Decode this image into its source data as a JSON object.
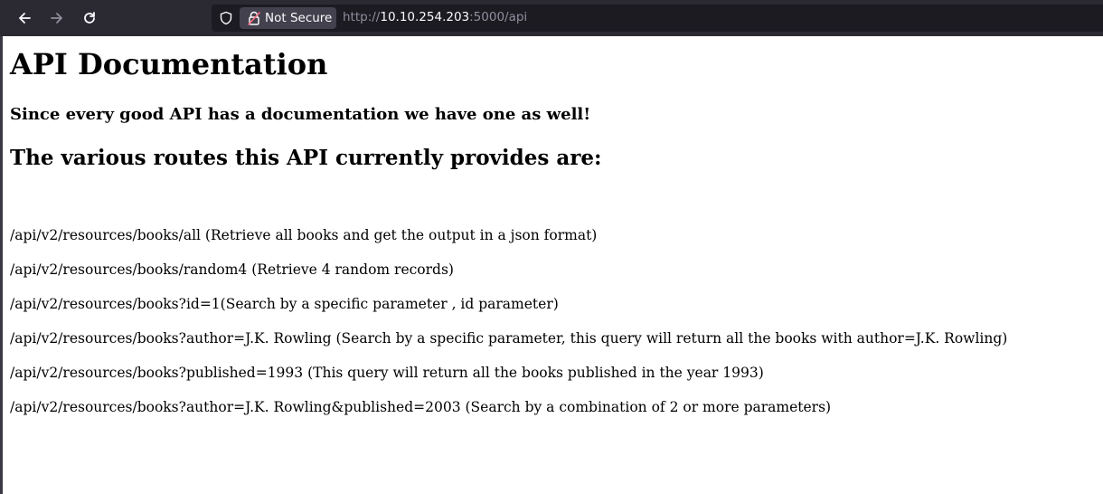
{
  "browser": {
    "security_label": "Not Secure",
    "url_scheme": "http://",
    "url_host": "10.10.254.203",
    "url_rest": ":5000/api"
  },
  "page": {
    "title": "API Documentation",
    "subtitle": "Since every good API has a documentation we have one as well!",
    "routes_heading": "The various routes this API currently provides are:",
    "routes": [
      "/api/v2/resources/books/all (Retrieve all books and get the output in a json format)",
      "/api/v2/resources/books/random4 (Retrieve 4 random records)",
      "/api/v2/resources/books?id=1(Search by a specific parameter , id parameter)",
      "/api/v2/resources/books?author=J.K. Rowling (Search by a specific parameter, this query will return all the books with author=J.K. Rowling)",
      "/api/v2/resources/books?published=1993 (This query will return all the books published in the year 1993)",
      "/api/v2/resources/books?author=J.K. Rowling&published=2003 (Search by a combination of 2 or more parameters)"
    ]
  }
}
